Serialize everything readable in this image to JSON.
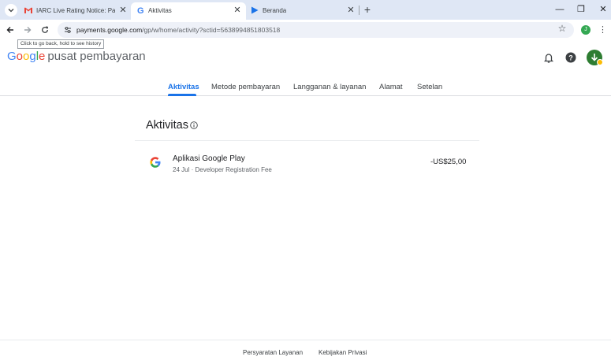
{
  "browser": {
    "tabs": [
      {
        "title": "IARC Live Rating Notice: Parking",
        "icon": "gmail-icon",
        "active": false
      },
      {
        "title": "Aktivitas",
        "icon": "google-icon",
        "active": true
      },
      {
        "title": "Beranda",
        "icon": "play-console-icon",
        "active": false
      }
    ],
    "url_host": "payments.google.com",
    "url_path": "/gp/w/home/activity?sctid=5638994851803518",
    "profile_initial": "J",
    "tooltip": "Click to go back, hold to see history"
  },
  "header": {
    "logo_text": "Google",
    "product_name": "pusat pembayaran"
  },
  "nav": {
    "tabs": [
      "Aktivitas",
      "Metode pembayaran",
      "Langganan & layanan",
      "Alamat",
      "Setelan"
    ],
    "active_index": 0
  },
  "main": {
    "title": "Aktivitas",
    "transactions": [
      {
        "merchant": "Aplikasi Google Play",
        "date": "24 Jul",
        "separator": " · ",
        "description": "Developer Registration Fee",
        "amount": "-US$25,00"
      }
    ]
  },
  "footer": {
    "links": [
      "Persyaratan Layanan",
      "Kebijakan Privasi"
    ]
  },
  "colors": {
    "accent": "#1a73e8",
    "tabbar": "#dfe7f5",
    "avatar": "#2e7d32",
    "badge": "#fbbc04"
  }
}
